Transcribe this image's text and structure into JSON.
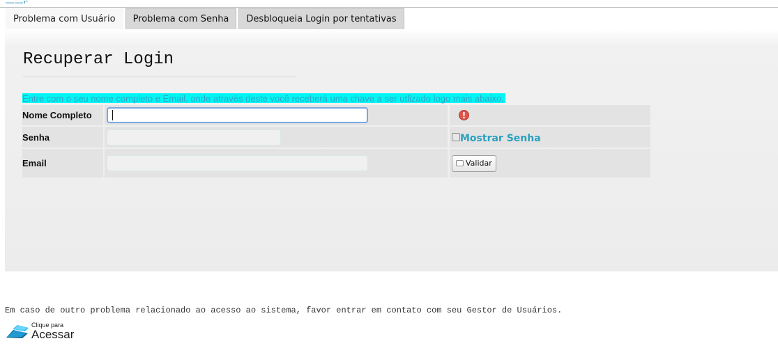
{
  "tabs": [
    {
      "label": "Problema com Usuário",
      "active": true
    },
    {
      "label": "Problema com Senha",
      "active": false
    },
    {
      "label": "Desbloqueia Login por tentativas",
      "active": false
    }
  ],
  "panel": {
    "title": "Recuperar Login",
    "instruction": "Entre com o seu nome completo e Email, onde através deste você receberá uma chave a ser utlizado logo mais abaixo."
  },
  "form": {
    "name_label": "Nome Completo",
    "name_value": "",
    "password_label": "Senha",
    "password_value": "",
    "email_label": "Email",
    "email_value": "",
    "show_password_label": "Mostrar Senha",
    "validate_label": "Validar"
  },
  "footer": {
    "text": "Em caso de outro problema relacionado ao acesso ao sistema, favor entrar em contato com seu Gestor de Usuários.",
    "access_small": "Clique para",
    "access_big": "Acessar"
  },
  "icons": {
    "error": "error-icon",
    "access": "access-logo-icon"
  },
  "colors": {
    "highlight": "#00f5f5",
    "accent_text": "#2aa0bf",
    "error": "#e0554a"
  }
}
